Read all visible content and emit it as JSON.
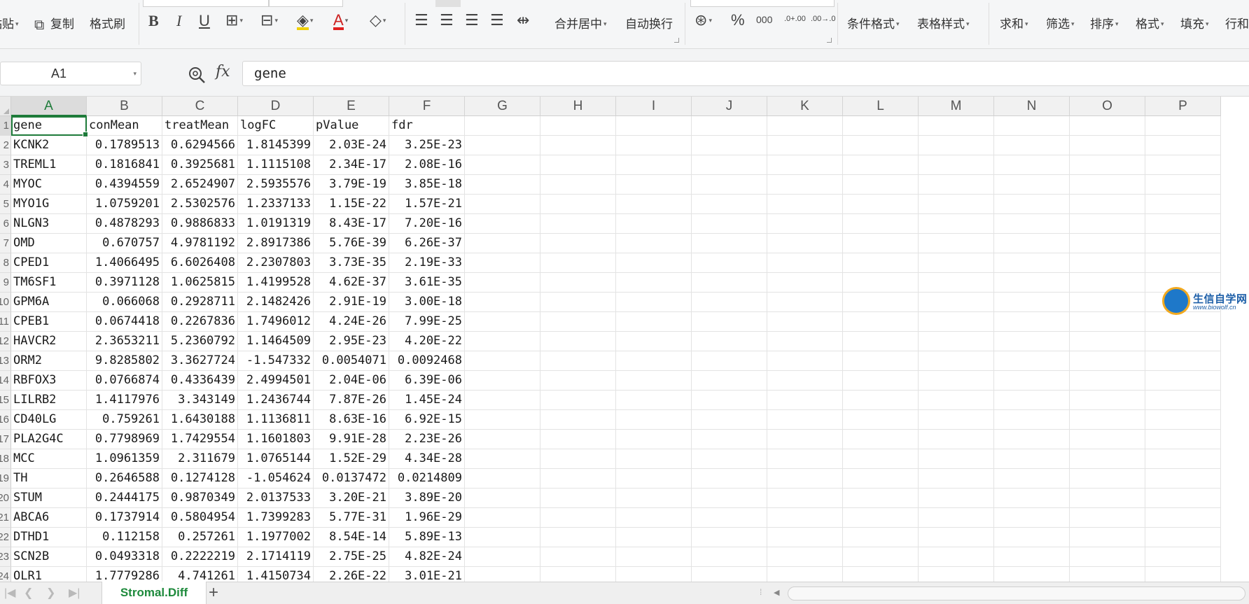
{
  "ribbon": {
    "paste_label": "粘贴",
    "copy_label": "复制",
    "format_painter_label": "格式刷",
    "bold": "B",
    "italic": "I",
    "underline": "U",
    "font_color_glyph": "A",
    "merge_center_label": "合并居中",
    "wrap_text_label": "自动换行",
    "percent_glyph": "%",
    "thousands_glyph": "000",
    "increase_decimal_glyph": ".0+.00",
    "decrease_decimal_glyph": ".00→.0",
    "conditional_format_label": "条件格式",
    "table_style_label": "表格样式",
    "sum_label": "求和",
    "filter_label": "筛选",
    "sort_label": "排序",
    "format_label": "格式",
    "fill_label": "填充",
    "row_col_label": "行和"
  },
  "formula_bar": {
    "name_box": "A1",
    "fx_label": "fx",
    "content": "gene"
  },
  "grid": {
    "columns": [
      "A",
      "B",
      "C",
      "D",
      "E",
      "F",
      "G",
      "H",
      "I",
      "J",
      "K",
      "L",
      "M",
      "N",
      "O",
      "P"
    ],
    "selected_column": "A",
    "row_numbers": [
      "1",
      "2",
      "3",
      "4",
      "5",
      "6",
      "7",
      "8",
      "9",
      "10",
      "11",
      "12",
      "13",
      "14",
      "15",
      "16",
      "17",
      "18",
      "19",
      "20",
      "21",
      "22",
      "23",
      "24"
    ],
    "rows": [
      [
        "gene",
        "conMean",
        "treatMean",
        "logFC",
        "pValue",
        "fdr"
      ],
      [
        "KCNK2",
        "0.1789513",
        "0.6294566",
        "1.8145399",
        "2.03E-24",
        "3.25E-23"
      ],
      [
        "TREML1",
        "0.1816841",
        "0.3925681",
        "1.1115108",
        "2.34E-17",
        "2.08E-16"
      ],
      [
        "MYOC",
        "0.4394559",
        "2.6524907",
        "2.5935576",
        "3.79E-19",
        "3.85E-18"
      ],
      [
        "MYO1G",
        "1.0759201",
        "2.5302576",
        "1.2337133",
        "1.15E-22",
        "1.57E-21"
      ],
      [
        "NLGN3",
        "0.4878293",
        "0.9886833",
        "1.0191319",
        "8.43E-17",
        "7.20E-16"
      ],
      [
        "OMD",
        "0.670757",
        "4.9781192",
        "2.8917386",
        "5.76E-39",
        "6.26E-37"
      ],
      [
        "CPED1",
        "1.4066495",
        "6.6026408",
        "2.2307803",
        "3.73E-35",
        "2.19E-33"
      ],
      [
        "TM6SF1",
        "0.3971128",
        "1.0625815",
        "1.4199528",
        "4.62E-37",
        "3.61E-35"
      ],
      [
        "GPM6A",
        "0.066068",
        "0.2928711",
        "2.1482426",
        "2.91E-19",
        "3.00E-18"
      ],
      [
        "CPEB1",
        "0.0674418",
        "0.2267836",
        "1.7496012",
        "4.24E-26",
        "7.99E-25"
      ],
      [
        "HAVCR2",
        "2.3653211",
        "5.2360792",
        "1.1464509",
        "2.95E-23",
        "4.20E-22"
      ],
      [
        "ORM2",
        "9.8285802",
        "3.3627724",
        "-1.547332",
        "0.0054071",
        "0.0092468"
      ],
      [
        "RBFOX3",
        "0.0766874",
        "0.4336439",
        "2.4994501",
        "2.04E-06",
        "6.39E-06"
      ],
      [
        "LILRB2",
        "1.4117976",
        "3.343149",
        "1.2436744",
        "7.87E-26",
        "1.45E-24"
      ],
      [
        "CD40LG",
        "0.759261",
        "1.6430188",
        "1.1136811",
        "8.63E-16",
        "6.92E-15"
      ],
      [
        "PLA2G4C",
        "0.7798969",
        "1.7429554",
        "1.1601803",
        "9.91E-28",
        "2.23E-26"
      ],
      [
        "MCC",
        "1.0961359",
        "2.311679",
        "1.0765144",
        "1.52E-29",
        "4.34E-28"
      ],
      [
        "TH",
        "0.2646588",
        "0.1274128",
        "-1.054624",
        "0.0137472",
        "0.0214809"
      ],
      [
        "STUM",
        "0.2444175",
        "0.9870349",
        "2.0137533",
        "3.20E-21",
        "3.89E-20"
      ],
      [
        "ABCA6",
        "0.1737914",
        "0.5804954",
        "1.7399283",
        "5.77E-31",
        "1.96E-29"
      ],
      [
        "DTHD1",
        "0.112158",
        "0.257261",
        "1.1977002",
        "8.54E-14",
        "5.89E-13"
      ],
      [
        "SCN2B",
        "0.0493318",
        "0.2222219",
        "2.1714119",
        "2.75E-25",
        "4.82E-24"
      ],
      [
        "OLR1",
        "1.7779286",
        "4.741261",
        "1.4150734",
        "2.26E-22",
        "3.01E-21"
      ]
    ]
  },
  "logo": {
    "title": "生信自学网",
    "subtitle": "www.biowolf.cn"
  },
  "sheet_tabs": {
    "active_tab": "Stromal.Diff",
    "add_glyph": "+"
  },
  "colors": {
    "accent_green": "#1e7b3a",
    "tab_text_green": "#1e8a3c",
    "header_bg": "#f1f1f1"
  }
}
